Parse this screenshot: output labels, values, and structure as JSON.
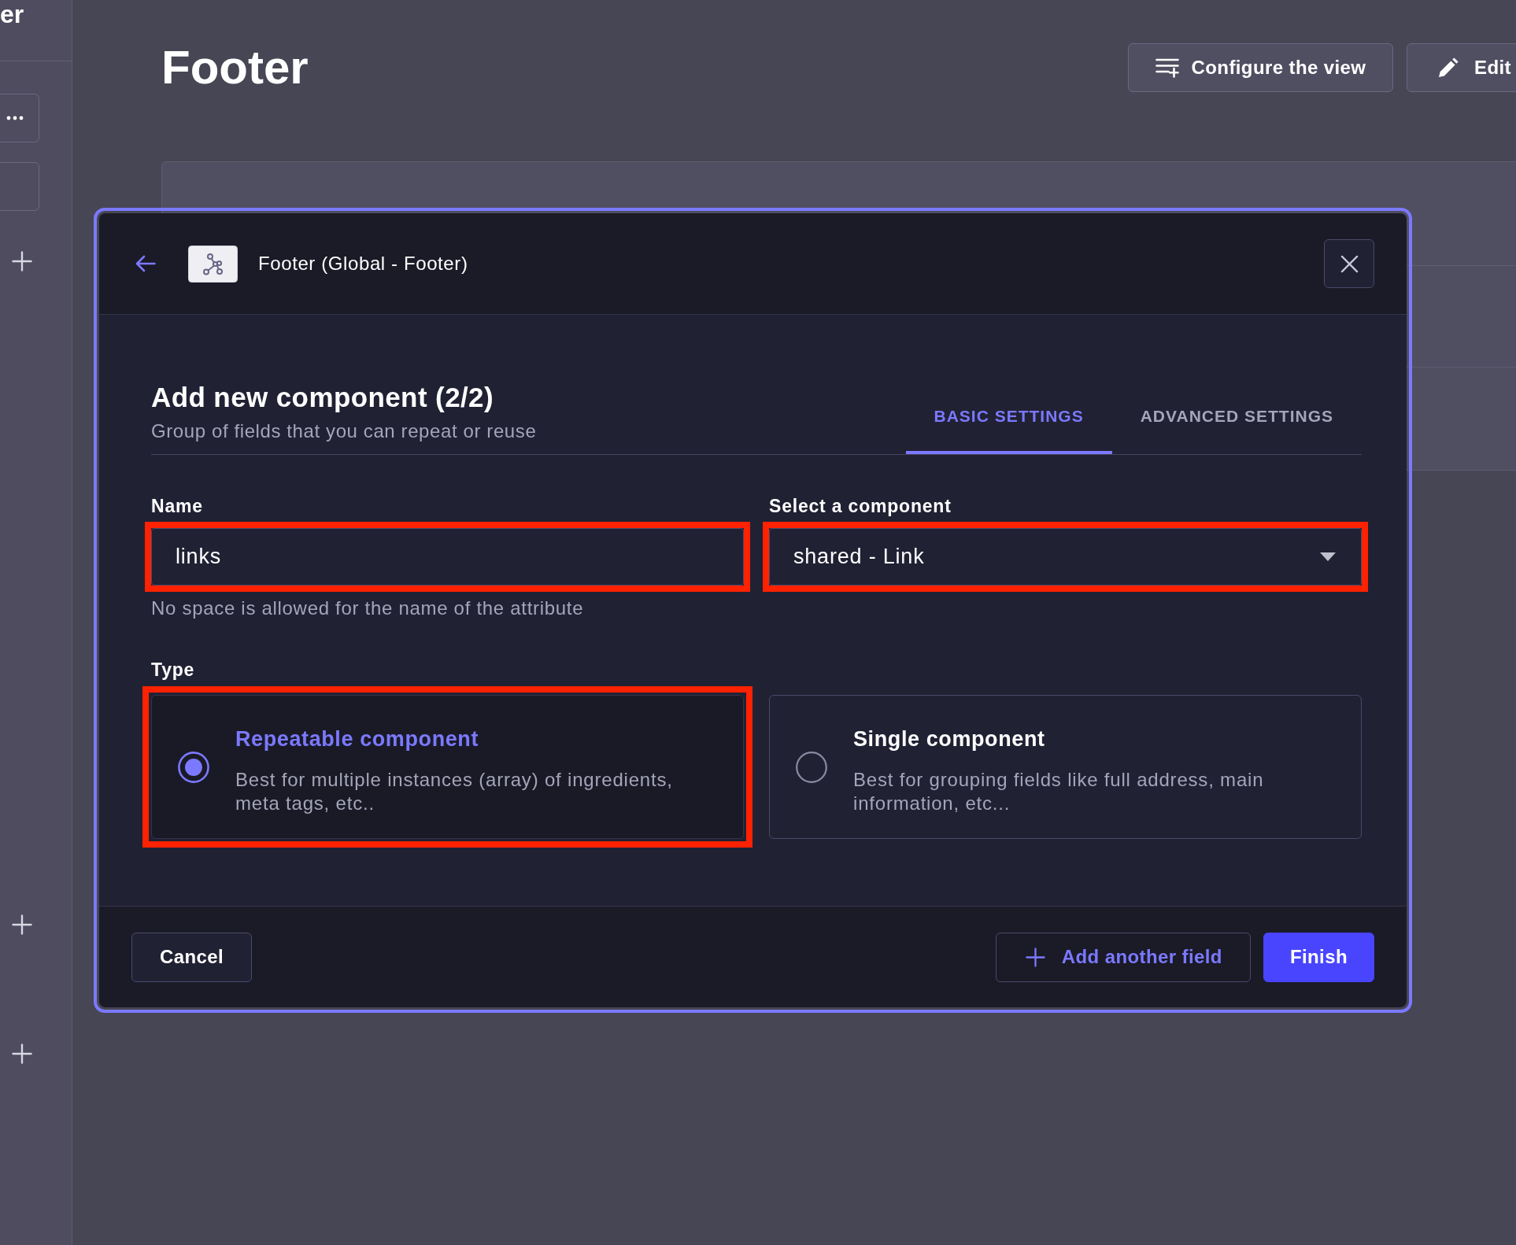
{
  "sidebar": {
    "title": "er"
  },
  "page": {
    "title": "Footer",
    "actions": [
      {
        "kind": "configure",
        "label": "Configure the view"
      },
      {
        "kind": "edit",
        "label": "Edit"
      }
    ]
  },
  "modal": {
    "breadcrumb": "Footer (Global - Footer)",
    "heading": "Add new component (2/2)",
    "subheading": "Group of fields that you can repeat or reuse",
    "tabs": [
      {
        "label": "BASIC SETTINGS",
        "selected": true
      },
      {
        "label": "ADVANCED SETTINGS",
        "selected": false
      }
    ],
    "fields": [
      {
        "kind": "text",
        "label": "Name",
        "value": "links",
        "hint": "No space is allowed for the name of the attribute",
        "highlighted": true
      },
      {
        "kind": "select",
        "label": "Select a component",
        "value": "shared - Link",
        "highlighted": true
      }
    ],
    "type": {
      "label": "Type",
      "options": [
        {
          "title": "Repeatable component",
          "description": "Best for multiple instances (array) of ingredients, meta tags, etc..",
          "selected": true,
          "highlighted": true
        },
        {
          "title": "Single component",
          "description": "Best for grouping fields like full address, main information, etc...",
          "selected": false,
          "highlighted": false
        }
      ]
    },
    "buttons": [
      {
        "kind": "cancel",
        "label": "Cancel"
      },
      {
        "kind": "add",
        "label": "Add another field"
      },
      {
        "kind": "primary",
        "label": "Finish"
      }
    ]
  }
}
